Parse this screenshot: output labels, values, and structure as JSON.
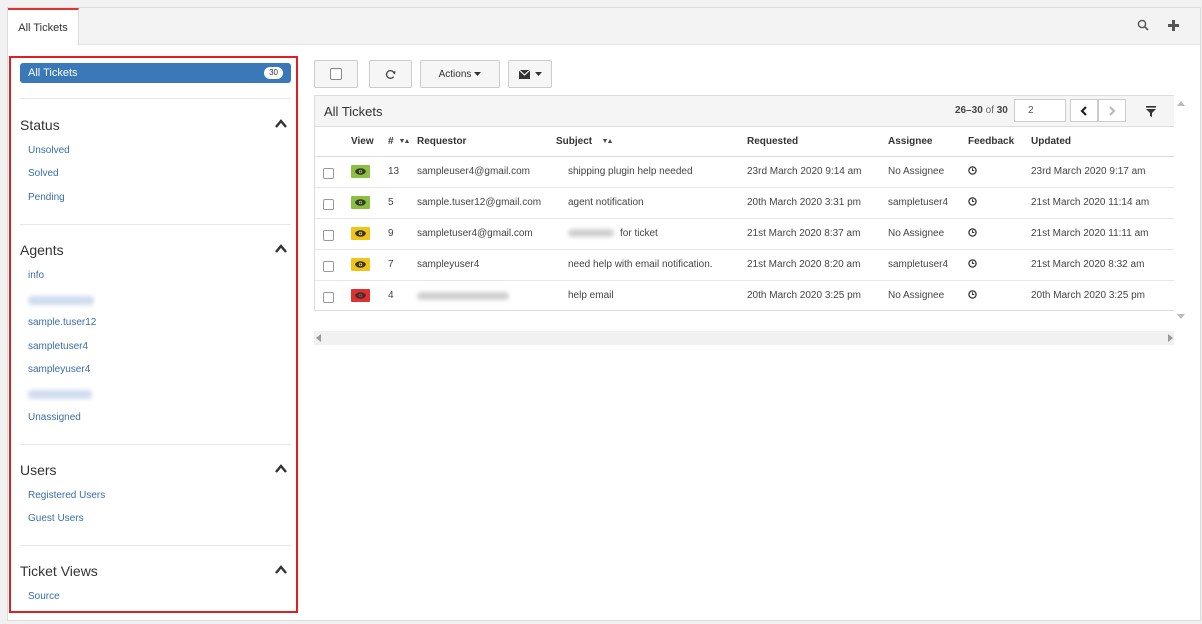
{
  "tabs": {
    "active_label": "All Tickets"
  },
  "top_icons": {
    "search": "search-icon",
    "add": "plus-icon"
  },
  "sidebar": {
    "all_tickets": {
      "label": "All Tickets",
      "count": "30"
    },
    "sections": {
      "status": {
        "title": "Status",
        "items": [
          "Unsolved",
          "Solved",
          "Pending"
        ]
      },
      "agents": {
        "title": "Agents",
        "items": [
          "info",
          "sample.tuser12",
          "sampletuser4",
          "sampleyuser4",
          "Unassigned"
        ]
      },
      "users": {
        "title": "Users",
        "items": [
          "Registered Users",
          "Guest Users"
        ]
      },
      "ticket_views": {
        "title": "Ticket Views",
        "items": [
          "Source"
        ]
      }
    }
  },
  "toolbar": {
    "actions_label": "Actions"
  },
  "panel": {
    "title": "All Tickets",
    "pager_range": "26–30",
    "pager_of": "of",
    "pager_total": "30",
    "page_value": "2"
  },
  "table": {
    "headers": {
      "view": "View",
      "num": "#",
      "requestor": "Requestor",
      "subject": "Subject",
      "requested": "Requested",
      "assignee": "Assignee",
      "feedback": "Feedback",
      "updated": "Updated"
    },
    "rows": [
      {
        "eye_color": "#8cbf3f",
        "num": "13",
        "requestor": "sampleuser4@gmail.com",
        "subject": "shipping plugin help needed",
        "requested": "23rd March 2020 9:14 am",
        "assignee": "No Assignee",
        "updated": "23rd March 2020 9:17 am"
      },
      {
        "eye_color": "#8cbf3f",
        "num": "5",
        "requestor": "sample.tuser12@gmail.com",
        "subject": "agent notification",
        "requested": "20th March 2020 3:31 pm",
        "assignee": "sampletuser4",
        "updated": "21st March 2020 11:14 am"
      },
      {
        "eye_color": "#f0c419",
        "num": "9",
        "requestor": "sampletuser4@gmail.com",
        "subject": "for ticket",
        "requested": "21st March 2020 8:37 am",
        "assignee": "No Assignee",
        "updated": "21st March 2020 11:11 am"
      },
      {
        "eye_color": "#f0c419",
        "num": "7",
        "requestor": "sampleyuser4",
        "subject": "need help with email notification.",
        "requested": "21st March 2020 8:20 am",
        "assignee": "sampletuser4",
        "updated": "21st March 2020 8:32 am"
      },
      {
        "eye_color": "#e03030",
        "num": "4",
        "requestor": "",
        "subject": "help email",
        "requested": "20th March 2020 3:25 pm",
        "assignee": "No Assignee",
        "updated": "20th March 2020 3:25 pm"
      }
    ]
  },
  "colors": {
    "accent": "#3a78b8",
    "highlight_border": "#e02020",
    "link": "#3a6ea5"
  }
}
